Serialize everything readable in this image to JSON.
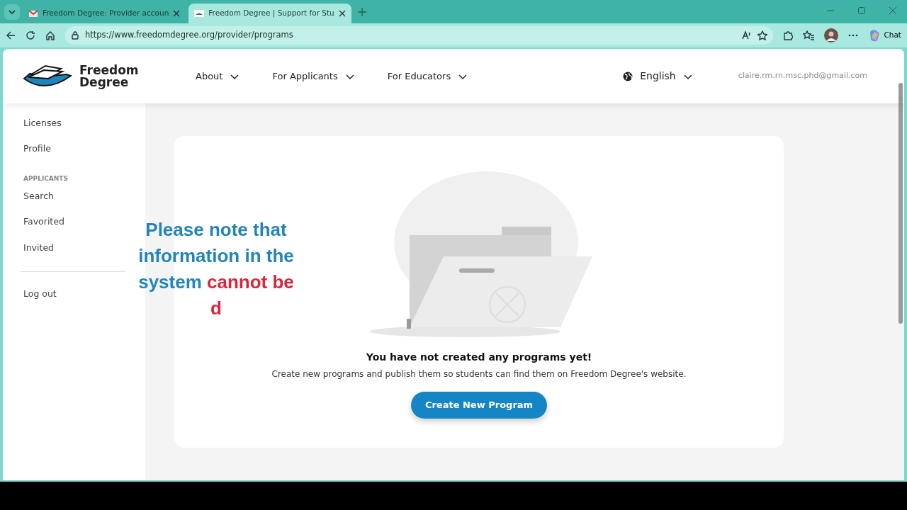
{
  "browser": {
    "tabs": [
      {
        "title": "Freedom Degree: Provider accoun",
        "selected": false
      },
      {
        "title": "Freedom Degree | Support for Stu",
        "selected": true
      }
    ],
    "url": "https://www.freedomdegree.org/provider/programs",
    "chat_label": "Chat"
  },
  "header": {
    "logo_lines": [
      "Freedom",
      "Degree"
    ],
    "nav": [
      "About",
      "For Applicants",
      "For Educators"
    ],
    "language": "English",
    "email": "claire.rm.rn.msc.phd@gmail.com"
  },
  "sidebar": {
    "items": [
      {
        "kind": "link",
        "label": "Licenses"
      },
      {
        "kind": "link",
        "label": "Profile"
      },
      {
        "kind": "heading",
        "label": "APPLICANTS"
      },
      {
        "kind": "link",
        "label": "Search"
      },
      {
        "kind": "link",
        "label": "Favorited"
      },
      {
        "kind": "link",
        "label": "Invited"
      },
      {
        "kind": "divider"
      },
      {
        "kind": "link",
        "label": "Log out"
      }
    ]
  },
  "empty_state": {
    "title": "You have not created any programs yet!",
    "message": "Create new programs and publish them so students can find them on Freedom Degree's website.",
    "button": "Create New Program"
  },
  "caption": {
    "lines": [
      [
        {
          "text": "Please note that",
          "emphasis": false
        }
      ],
      [
        {
          "text": "information in the",
          "emphasis": false
        }
      ],
      [
        {
          "text": "system ",
          "emphasis": false
        },
        {
          "text": "cannot be",
          "emphasis": true
        }
      ],
      [
        {
          "text": "d",
          "emphasis": true
        }
      ]
    ]
  }
}
